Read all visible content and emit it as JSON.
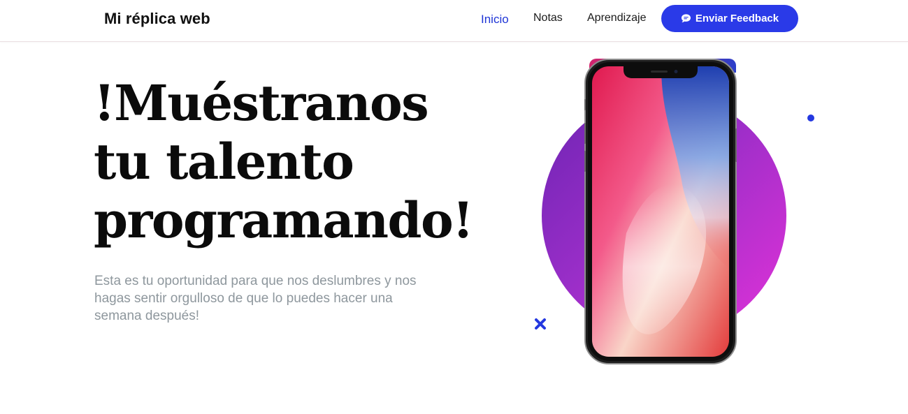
{
  "header": {
    "brand": "Mi réplica web",
    "nav": [
      {
        "label": "Inicio",
        "active": true
      },
      {
        "label": "Notas",
        "active": false
      },
      {
        "label": "Aprendizaje",
        "active": false
      }
    ],
    "feedback_button": {
      "label": "Enviar Feedback",
      "icon": "comment-icon"
    }
  },
  "hero": {
    "title_lines": [
      "!Muéstranos",
      "tu talento",
      "programando!"
    ],
    "subtitle": "Esta es tu oportunidad para que nos deslumbres y nos hagas sentir orgulloso de que lo puedes hacer una semana después!"
  },
  "colors": {
    "accent": "#2a3ae8",
    "active_link": "#1f35d6",
    "blob_start": "#6d24b3",
    "blob_end": "#e232d8",
    "subtitle": "#8e979d"
  }
}
